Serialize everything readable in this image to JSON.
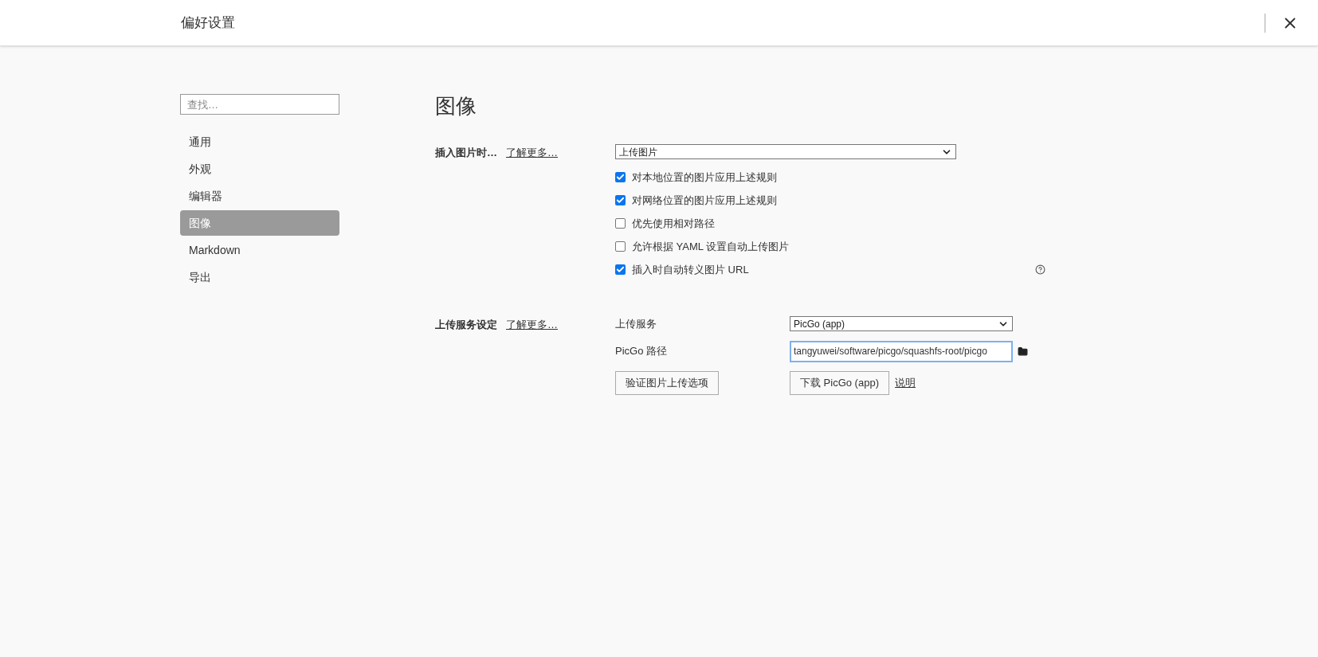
{
  "window": {
    "title": "偏好设置"
  },
  "sidebar": {
    "search": {
      "placeholder": "查找…"
    },
    "items": [
      {
        "label": "通用",
        "selected": false
      },
      {
        "label": "外观",
        "selected": false
      },
      {
        "label": "编辑器",
        "selected": false
      },
      {
        "label": "图像",
        "selected": true
      },
      {
        "label": "Markdown",
        "selected": false
      },
      {
        "label": "导出",
        "selected": false
      }
    ]
  },
  "content": {
    "heading": "图像",
    "insert_section": {
      "label": "插入图片时…",
      "link": "了解更多…",
      "select": {
        "value": "上传图片"
      },
      "options": [
        {
          "label": "对本地位置的图片应用上述规则",
          "checked": true
        },
        {
          "label": "对网络位置的图片应用上述规则",
          "checked": true
        },
        {
          "label": "优先使用相对路径",
          "checked": false
        },
        {
          "label": "允许根据 YAML 设置自动上传图片",
          "checked": false
        },
        {
          "label": "插入时自动转义图片 URL",
          "checked": true
        }
      ]
    },
    "upload_section": {
      "label": "上传服务设定",
      "link": "了解更多…",
      "service": {
        "label": "上传服务",
        "value": "PicGo (app)"
      },
      "path": {
        "label": "PicGo 路径",
        "value": "tangyuwei/software/picgo/squashfs-root/picgo"
      },
      "verify_button": "验证图片上传选项",
      "download_button": "下载 PicGo (app)",
      "help_link": "说明"
    }
  }
}
